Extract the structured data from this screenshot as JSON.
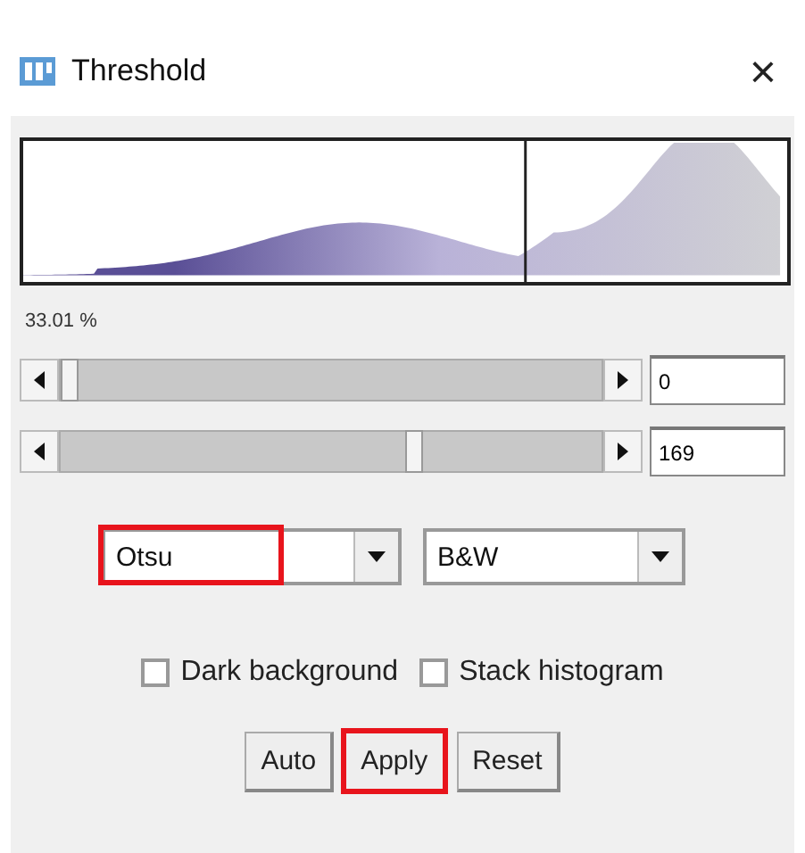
{
  "window": {
    "title": "Threshold",
    "close": "×"
  },
  "histogram": {
    "readout": "33.01 %"
  },
  "sliders": [
    {
      "level": 0.0,
      "value": "0"
    },
    {
      "level": 0.66,
      "value": "169"
    }
  ],
  "dropdowns": [
    {
      "value": "Otsu",
      "highlighted": true
    },
    {
      "value": "B&W",
      "highlighted": false
    }
  ],
  "checkboxes": [
    {
      "label": "Dark background",
      "checked": false
    },
    {
      "label": "Stack histogram",
      "checked": false
    }
  ],
  "buttons": [
    {
      "label": "Auto",
      "highlighted": false
    },
    {
      "label": "Apply",
      "highlighted": true
    },
    {
      "label": "Reset",
      "highlighted": false
    }
  ]
}
